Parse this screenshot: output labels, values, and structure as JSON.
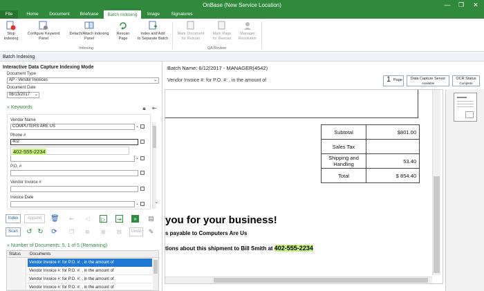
{
  "window": {
    "title": "OnBase (New Service Location)",
    "minimize": "—",
    "restore": "❐",
    "close": "✕"
  },
  "tabs": [
    "File",
    "Home",
    "Document",
    "Briefcase",
    "Batch Indexing",
    "Image",
    "Signatures"
  ],
  "ribbon": {
    "stop_indexing": "Stop\nIndexing",
    "configure_keyword_panel": "Configure Keyword\nPanel",
    "detach_attach": "Detach/Attach Indexing\nPanel",
    "rescan_page": "Rescan\nPage",
    "index_add_separate": "Index and Add\nto Separate Batch",
    "group_indexing": "Indexing",
    "mark_doc_rescan": "Mark Document\nfor Rescan",
    "mark_page_rescan": "Mark Page\nfor Rescan",
    "manager_resolution": "Manager\nResolution",
    "group_qa": "QA Review"
  },
  "section_title": "Batch Indexing",
  "left": {
    "mode_title": "Interactive Data Capture Indexing Mode",
    "doc_type_label": "Document Type",
    "doc_type_value": "AP - Vendor Invoices",
    "doc_date_label": "Document Date",
    "doc_date_value": "06/13/2017",
    "keywords_title": "Keywords",
    "vendor_name_label": "Vendor Name",
    "vendor_name_value": "COMPUTERS ARE US",
    "phone_label": "Phone #",
    "phone_value": "402",
    "phone_suggestion": "402-555-2234",
    "po_label": "P.O. #",
    "vendor_invoice_label": "Vendor Invoice #",
    "invoice_date_label": "Invoice Date",
    "btn_index": "Index",
    "btn_append": "Append",
    "btn_scan": "Scan",
    "btn_undo": "Undo",
    "docs_title": "Number of Documents: 5, 1 of 5 (Remaining)",
    "col_status": "Status",
    "col_documents": "Documents",
    "rows": [
      "Vendor Invoice #:  for P.O. #: , in the amount of",
      "Vendor Invoice #:  for P.O. #: , in the amount of",
      "Vendor Invoice #:  for P.O. #: , in the amount of",
      "Vendor Invoice #:  for P.O. #: , in the amount of"
    ]
  },
  "right": {
    "batch_name": "Batch Name: 6/12/2017 - MANAGER(4542)",
    "doc_subtitle": "Vendor Invoice #:  for P.O. #: , in the amount of",
    "page_count": "1",
    "page_label": "Page",
    "dcs_label": "Data Capture Server",
    "dcs_status": "Available",
    "ocr_label": "OCR Status",
    "ocr_status": "Complete"
  },
  "invoice": {
    "rows": [
      {
        "label": "Subtotal",
        "value": "$801.00"
      },
      {
        "label": "Sales Tax",
        "value": ""
      },
      {
        "label": "Shipping and Handling",
        "value": "53.40"
      },
      {
        "label": "Total",
        "value": "$ 854.40"
      }
    ],
    "thanks": "you for your business!",
    "payable": "s payable to Computers Are Us",
    "questions_prefix": "tions about this shipment to Bill Smith at ",
    "questions_phone": "402-555-2234"
  },
  "colors": {
    "brand_green": "#2f8a3e",
    "selection_blue": "#1e78d4",
    "highlight": "#c4f27a"
  }
}
